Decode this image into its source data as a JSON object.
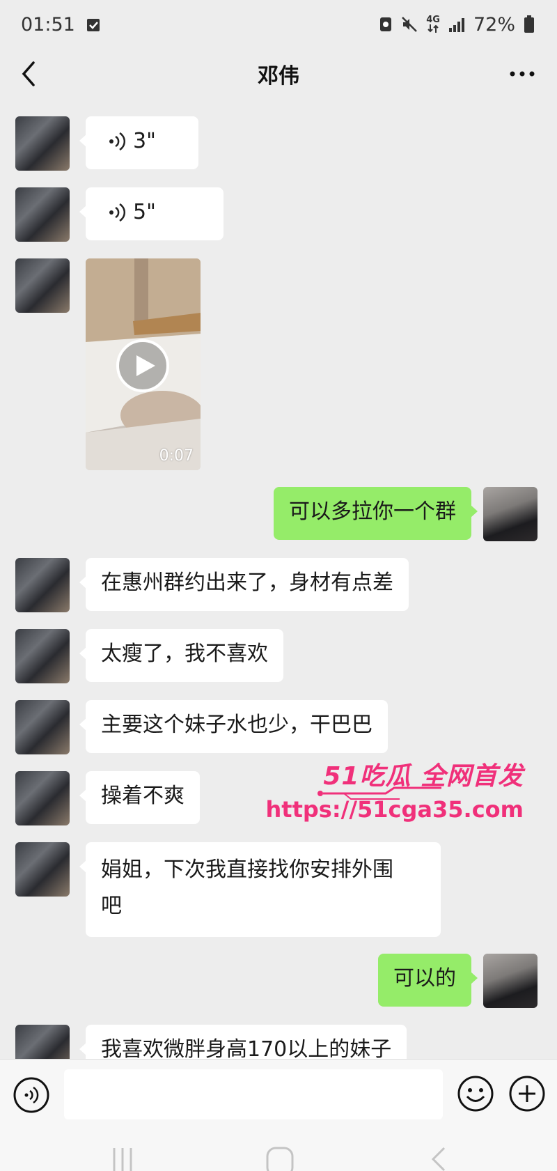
{
  "status_bar": {
    "time": "01:51",
    "network": "4G",
    "battery": "72%"
  },
  "nav": {
    "title": "邓伟"
  },
  "messages": [
    {
      "type": "voice",
      "side": "left",
      "duration": "3\""
    },
    {
      "type": "voice",
      "side": "left",
      "duration": "5\""
    },
    {
      "type": "video",
      "side": "left",
      "duration": "0:07"
    },
    {
      "type": "text",
      "side": "right",
      "text": "可以多拉你一个群"
    },
    {
      "type": "text",
      "side": "left",
      "text": "在惠州群约出来了，身材有点差"
    },
    {
      "type": "text",
      "side": "left",
      "text": "太瘦了，我不喜欢"
    },
    {
      "type": "text",
      "side": "left",
      "text": "主要这个妹子水也少，干巴巴"
    },
    {
      "type": "text",
      "side": "left",
      "text": "操着不爽"
    },
    {
      "type": "text",
      "side": "left",
      "text_line1": "娟姐，下次我直接找你安排外围",
      "text_line2": "吧"
    },
    {
      "type": "text",
      "side": "right",
      "text": "可以的"
    },
    {
      "type": "text",
      "side": "left",
      "text": "我喜欢微胖身高170以上的妹子"
    }
  ],
  "watermark": {
    "line1": "51吃瓜 全网首发",
    "line2": "https://51cga35.com"
  },
  "colors": {
    "background": "#ededed",
    "bubble_self": "#95ec69",
    "bubble_other": "#ffffff",
    "watermark": "#f0307a"
  },
  "icons": {
    "back": "chevron-left-icon",
    "more": "more-dots-icon",
    "voice_msg": "voice-wave-icon",
    "play": "play-icon",
    "input_voice": "voice-input-icon",
    "emoji": "emoji-icon",
    "plus": "plus-icon"
  }
}
